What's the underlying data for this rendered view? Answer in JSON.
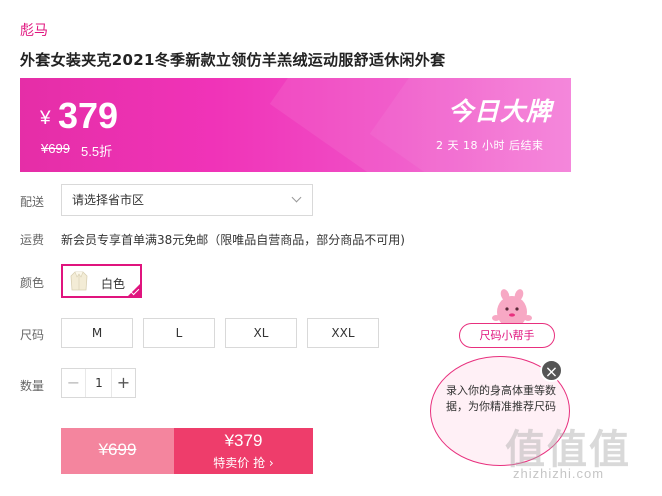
{
  "brand": "彪马",
  "product_title": "外套女装夹克2021冬季新款立领仿羊羔绒运动服舒适休闲外套",
  "banner": {
    "currency": "¥",
    "price": "379",
    "original_price": "¥699",
    "discount": "5.5折",
    "badge": "今日大牌",
    "countdown": "2 天 18 小时 后结束",
    "colors": {
      "start": "#e52ea7",
      "end": "#f476d6"
    }
  },
  "delivery": {
    "label": "配送",
    "placeholder": "请选择省市区"
  },
  "shipping": {
    "label": "运费",
    "text": "新会员专享首单满38元免邮（限唯品自营商品，部分商品不可用)"
  },
  "color": {
    "label": "颜色",
    "options": [
      {
        "name": "白色",
        "selected": true
      }
    ]
  },
  "size": {
    "label": "尺码",
    "options": [
      "M",
      "L",
      "XL",
      "XXL"
    ]
  },
  "quantity": {
    "label": "数量",
    "value": "1",
    "minus": "−",
    "plus": "+"
  },
  "buy": {
    "original_price": "¥699",
    "special_price": "¥379",
    "cta": "特卖价 抢 ›"
  },
  "size_helper": {
    "label": "尺码小帮手",
    "tip": "录入你的身高体重等数据，为你精准推荐尺码",
    "close": "×"
  },
  "watermark": {
    "logo": "值值值",
    "site": "zhizhizhi.com"
  },
  "accent_color": "#e0147e"
}
